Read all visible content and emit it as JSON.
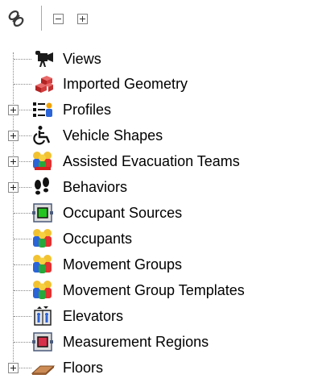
{
  "toolbar": {
    "link_icon": "link-chain-icon",
    "collapse_icon": "collapse-all-icon",
    "expand_icon": "expand-all-icon"
  },
  "tree": {
    "items": [
      {
        "label": "Views",
        "icon": "camera-icon",
        "expandable": false
      },
      {
        "label": "Imported Geometry",
        "icon": "blocks-icon",
        "expandable": false
      },
      {
        "label": "Profiles",
        "icon": "profile-list-icon",
        "expandable": true
      },
      {
        "label": "Vehicle Shapes",
        "icon": "wheelchair-icon",
        "expandable": true
      },
      {
        "label": "Assisted Evacuation Teams",
        "icon": "team-icon",
        "expandable": true
      },
      {
        "label": "Behaviors",
        "icon": "footprints-icon",
        "expandable": true
      },
      {
        "label": "Occupant Sources",
        "icon": "occupant-source-icon",
        "expandable": false
      },
      {
        "label": "Occupants",
        "icon": "occupants-icon",
        "expandable": false
      },
      {
        "label": "Movement Groups",
        "icon": "movement-groups-icon",
        "expandable": false
      },
      {
        "label": "Movement Group Templates",
        "icon": "movement-group-templates-icon",
        "expandable": false
      },
      {
        "label": "Elevators",
        "icon": "elevator-icon",
        "expandable": false
      },
      {
        "label": "Measurement Regions",
        "icon": "measurement-region-icon",
        "expandable": false
      },
      {
        "label": "Floors",
        "icon": "floor-icon",
        "expandable": true
      }
    ]
  }
}
